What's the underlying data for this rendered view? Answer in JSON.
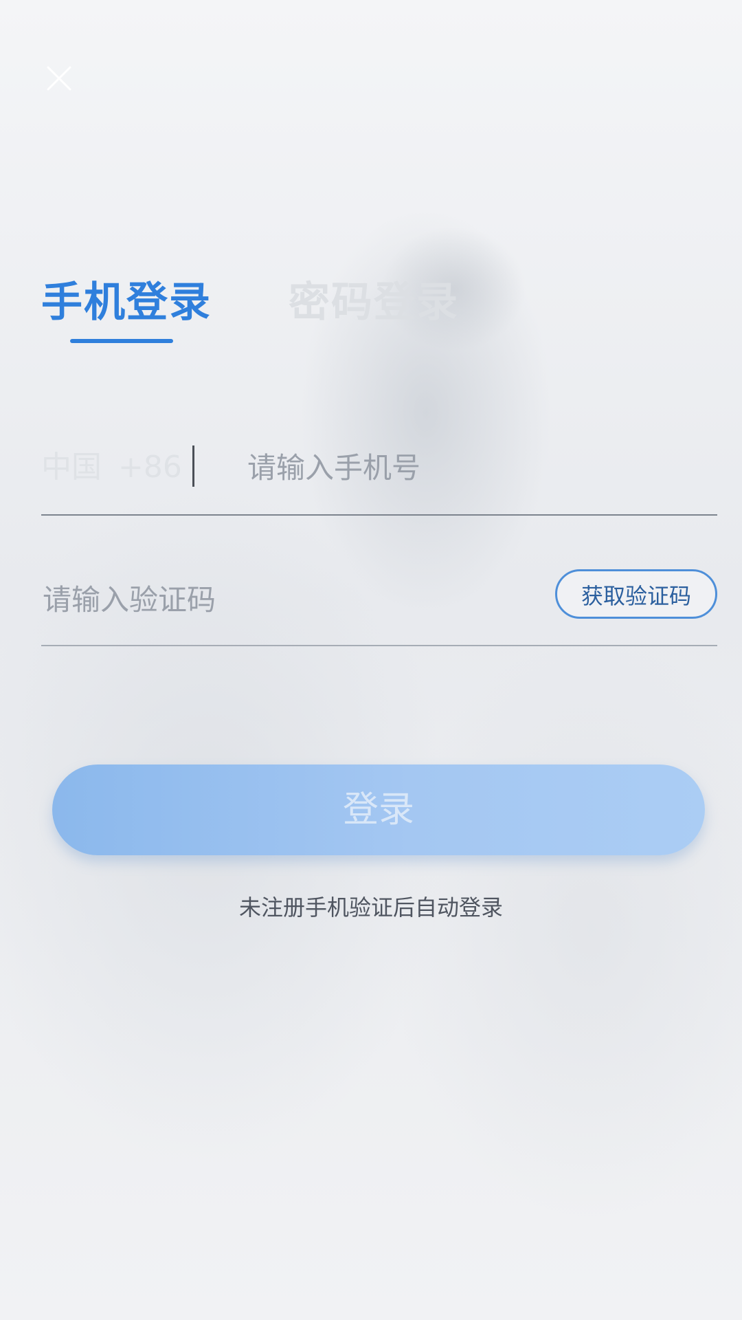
{
  "tabs": {
    "active_label": "手机登录",
    "inactive_label": "密码登录"
  },
  "phone_row": {
    "country": "中国",
    "country_code": "+86",
    "placeholder": "请输入手机号"
  },
  "code_row": {
    "placeholder": "请输入验证码",
    "get_code_label": "获取验证码"
  },
  "login": {
    "button_label": "登录",
    "hint": "未注册手机验证后自动登录"
  },
  "colors": {
    "accent": "#2f7fdc",
    "button": "#9fc4f0"
  },
  "icons": {
    "close": "close-icon"
  }
}
